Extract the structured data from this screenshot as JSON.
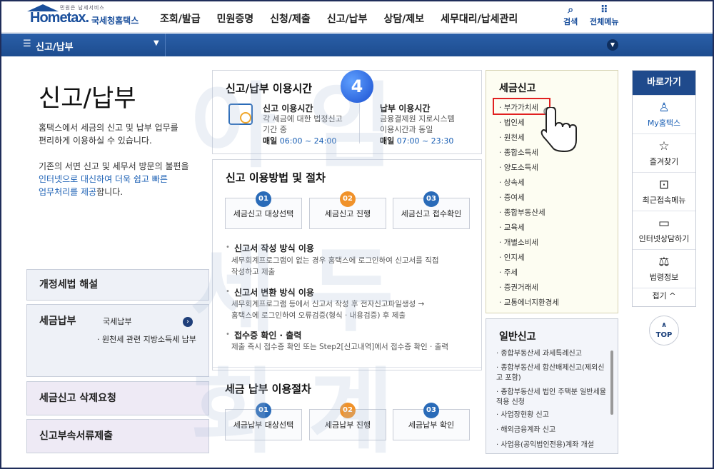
{
  "header": {
    "logo_tagline": "민원은 납세서비스",
    "logo_text": "Hometax.",
    "logo_sub": "국세청홈택스",
    "nav": [
      "조회/발급",
      "민원증명",
      "신청/제출",
      "신고/납부",
      "상담/제보",
      "세무대리/납세관리"
    ],
    "search_label": "검색",
    "allmenu_label": "전체메뉴"
  },
  "breadcrumb": {
    "current": "신고/납부"
  },
  "watermark": [
    "아 임",
    "세 두",
    "회 계"
  ],
  "left": {
    "title": "신고/납부",
    "desc1": [
      "홈택스에서 세금의 신고 및 납부 업무를",
      "편리하게 이용하실 수 있습니다."
    ],
    "desc2_a": "기존의 서면 신고 및 세무서 방문의 불편을",
    "desc2_b_hl": "인터넷으로 대신하여 더욱 쉽고 빠른",
    "desc2_c_hl": "업무처리를 제공",
    "desc2_c_rest": "합니다.",
    "box_reform": "개정세법 해설",
    "box_pay": "세금납부",
    "pay_items": [
      "국세납부",
      "· 원천세 관련 지방소득세 납부"
    ],
    "box_delete": "세금신고 삭제요청",
    "box_docs": "신고부속서류제출"
  },
  "hours": {
    "title": "신고/납부 이용시간",
    "badge": "4",
    "filing_title": "신고 이용시간",
    "filing_desc": [
      "각 세금에 대한 법정신고",
      "기간 중"
    ],
    "filing_daily": "매일",
    "filing_time": "06:00 ~ 24:00",
    "pay_title": "납부 이용시간",
    "pay_desc": [
      "금융결제원 지로시스템",
      "이용시간과 동일"
    ],
    "pay_daily": "매일",
    "pay_time": "07:00 ~ 23:30"
  },
  "procedure": {
    "title": "신고 이용방법 및 절차",
    "steps": [
      {
        "num": "01",
        "label": "세금신고 대상선택"
      },
      {
        "num": "02",
        "label": "세금신고 진행"
      },
      {
        "num": "03",
        "label": "세금신고 접수확인"
      }
    ],
    "method1_title": "신고서 작성 방식 이용",
    "method1_body": [
      "세무회계프로그램이 없는 경우 홈택스에 로그인하여 신고서를 직접",
      "작성하고 제출"
    ],
    "method2_title": "신고서 변환 방식 이용",
    "method2_body": [
      "세무회계프로그램 등에서 신고서 작성 후 전자신고파일생성 →",
      "홈택스에 로그인하여 오류검증(형식 · 내용검증) 후 제출"
    ],
    "method3_title": "접수증 확인 · 출력",
    "method3_body": [
      "제출 즉시 접수증 확인 또는 Step2[신고내역]에서 접수증 확인 · 출력"
    ]
  },
  "payproc": {
    "title": "세금 납부 이용절차",
    "steps": [
      {
        "num": "01",
        "label": "세금납부 대상선택"
      },
      {
        "num": "02",
        "label": "세금납부 진행"
      },
      {
        "num": "03",
        "label": "세금납부 확인"
      }
    ]
  },
  "taxreport": {
    "title": "세금신고",
    "items": [
      "부가가치세",
      "법인세",
      "원천세",
      "종합소득세",
      "양도소득세",
      "상속세",
      "증여세",
      "종합부동산세",
      "교육세",
      "개별소비세",
      "인지세",
      "주세",
      "증권거래세",
      "교통에너지환경세"
    ]
  },
  "general": {
    "title": "일반신고",
    "items": [
      "종합부동산세 과세특례신고",
      "종합부동산세 합산배제신고(제외신고 포함)",
      "종합부동산세 법인 주택분 일반세율 적용 신청",
      "사업장현황 신고",
      "해외금융계좌 신고",
      "사업용(공익법인전용)계좌 개설"
    ]
  },
  "quick": {
    "title": "바로가기",
    "items": [
      "My홈택스",
      "즐겨찾기",
      "최근접속메뉴",
      "인터넷상담하기",
      "법령정보"
    ],
    "fold": "접기 ^",
    "top": "TOP"
  }
}
